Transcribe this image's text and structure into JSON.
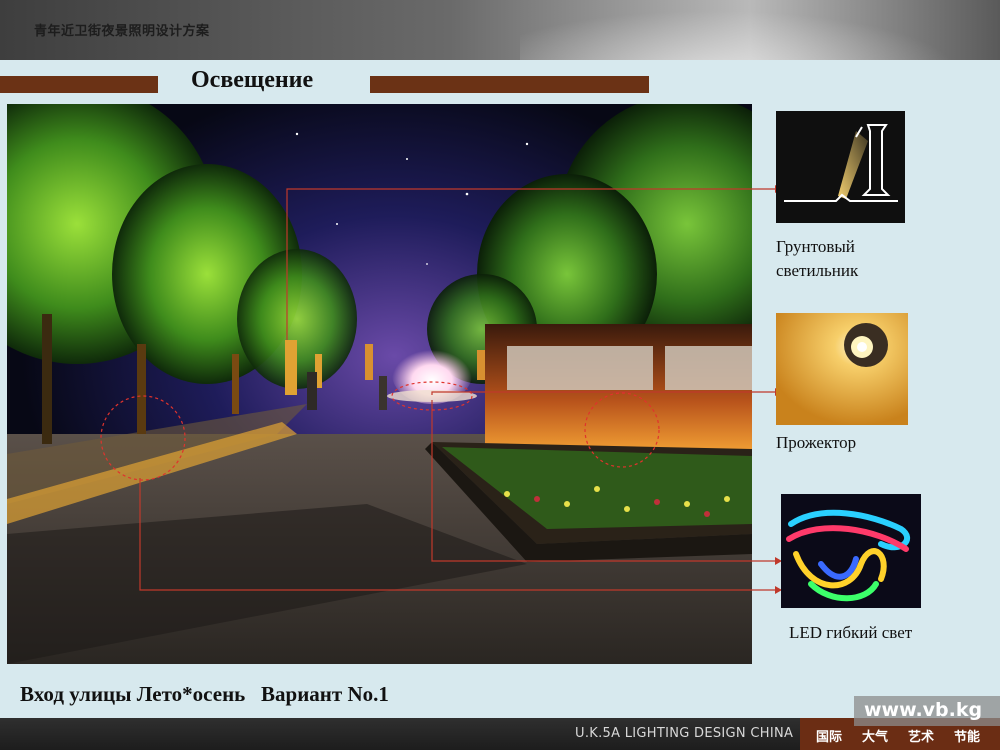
{
  "header": {
    "doc_title": "青年近卫街夜景照明设计方案"
  },
  "section": {
    "heading": "Освещение"
  },
  "fixtures": [
    {
      "label": "Грунтовый\nсветильник",
      "icon": "ground-light-sketch"
    },
    {
      "label": "Прожектор",
      "icon": "spotlight-photo"
    },
    {
      "label": "LED гибкий свет",
      "icon": "led-flex-strip-photo"
    }
  ],
  "caption": "Вход улицы Лето*осень   Вариант No.1",
  "footer": {
    "brand": "U.K.5A LIGHTING DESIGN CHINA",
    "tags": [
      "国际",
      "大气",
      "艺术",
      "节能"
    ]
  },
  "watermark": "www.vb.kg",
  "colors": {
    "accent_bar": "#6b3215",
    "callout_line": "#c0392b",
    "background": "#d7e9ee"
  }
}
